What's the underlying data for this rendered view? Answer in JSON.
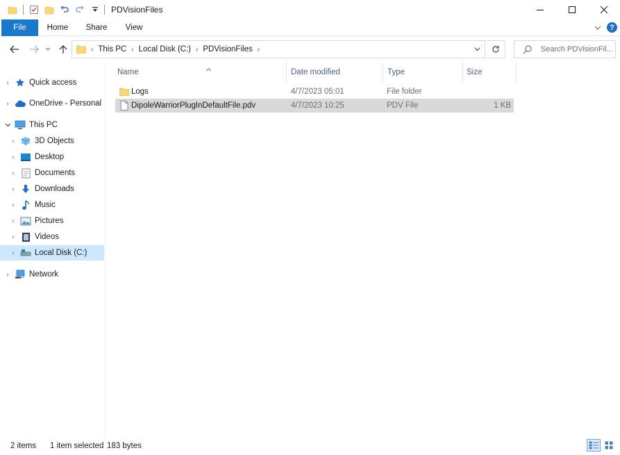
{
  "window": {
    "title": "PDVisionFiles"
  },
  "ribbon": {
    "tabs": [
      {
        "label": "File"
      },
      {
        "label": "Home"
      },
      {
        "label": "Share"
      },
      {
        "label": "View"
      }
    ]
  },
  "address": {
    "breadcrumbs": [
      "This PC",
      "Local Disk (C:)",
      "PDVisionFiles"
    ],
    "search_placeholder": "Search PDVisionFil..."
  },
  "nav": {
    "items": [
      {
        "label": "Quick access",
        "icon": "star-icon"
      },
      {
        "label": "OneDrive - Personal",
        "icon": "cloud-icon"
      },
      {
        "label": "This PC",
        "icon": "computer-icon"
      },
      {
        "label": "3D Objects",
        "icon": "cube-icon"
      },
      {
        "label": "Desktop",
        "icon": "desktop-icon"
      },
      {
        "label": "Documents",
        "icon": "documents-icon"
      },
      {
        "label": "Downloads",
        "icon": "download-icon"
      },
      {
        "label": "Music",
        "icon": "music-icon"
      },
      {
        "label": "Pictures",
        "icon": "pictures-icon"
      },
      {
        "label": "Videos",
        "icon": "videos-icon"
      },
      {
        "label": "Local Disk (C:)",
        "icon": "drive-icon"
      },
      {
        "label": "Network",
        "icon": "network-icon"
      }
    ]
  },
  "columns": {
    "name": "Name",
    "date": "Date modified",
    "type": "Type",
    "size": "Size"
  },
  "files": [
    {
      "name": "Logs",
      "date": "4/7/2023 05:01",
      "type": "File folder",
      "size": "",
      "icon": "folder-icon"
    },
    {
      "name": "DipoleWarriorPlugInDefaultFile.pdv",
      "date": "4/7/2023 10:25",
      "type": "PDV File",
      "size": "1 KB",
      "icon": "file-icon"
    }
  ],
  "status": {
    "count": "2 items",
    "selected": "1 item selected",
    "bytes": "183 bytes"
  },
  "colors": {
    "accent": "#1979ca",
    "selection": "#cce8ff",
    "row_selected": "#d9d9d9",
    "folder": "#f8d775"
  }
}
